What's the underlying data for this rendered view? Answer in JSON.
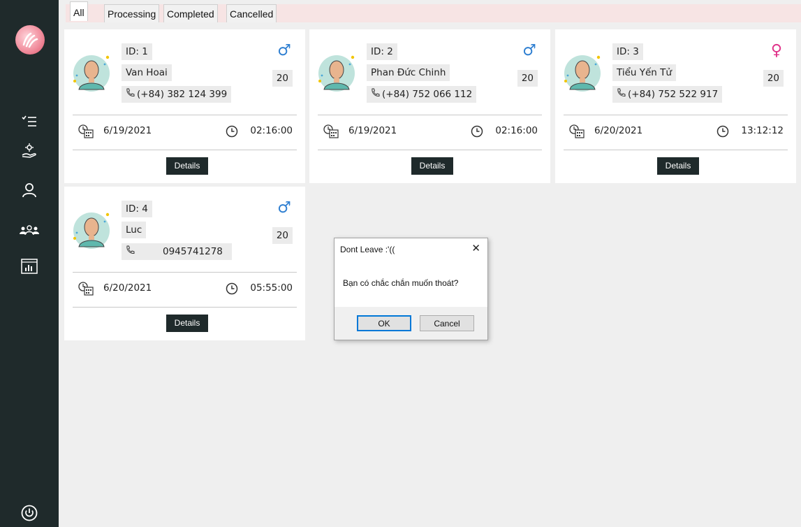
{
  "tabs": [
    {
      "label": "All",
      "active": true
    },
    {
      "label": "Processing",
      "active": false
    },
    {
      "label": "Completed",
      "active": false
    },
    {
      "label": "Cancelled",
      "active": false
    }
  ],
  "sidebar": {
    "items": [
      {
        "icon": "checklist-icon"
      },
      {
        "icon": "hand-gear-icon"
      },
      {
        "icon": "user-icon"
      },
      {
        "icon": "users-group-icon"
      },
      {
        "icon": "report-chart-icon"
      }
    ],
    "power_icon": "power-icon"
  },
  "cards": [
    {
      "id": "ID: 1",
      "name": "Van Hoai",
      "phone": "(+84) 382 124 399",
      "gender": "male",
      "age": "20",
      "date": "6/19/2021",
      "time": "02:16:00",
      "details_label": "Details"
    },
    {
      "id": "ID: 2",
      "name": "Phan Đức Chinh",
      "phone": "(+84) 752 066 112",
      "gender": "male",
      "age": "20",
      "date": "6/19/2021",
      "time": "02:16:00",
      "details_label": "Details"
    },
    {
      "id": "ID: 3",
      "name": "Tiểu Yến Tử",
      "phone": "(+84) 752 522 917",
      "gender": "female",
      "age": "20",
      "date": "6/20/2021",
      "time": "13:12:12",
      "details_label": "Details"
    },
    {
      "id": "ID: 4",
      "name": "Luc",
      "phone": "0945741278",
      "gender": "male",
      "age": "20",
      "date": "6/20/2021",
      "time": "05:55:00",
      "details_label": "Details"
    }
  ],
  "dialog": {
    "title": "Dont Leave :'((",
    "message": "Bạn có chắc chắn muốn thoát?",
    "ok_label": "OK",
    "cancel_label": "Cancel"
  },
  "colors": {
    "sidebar_bg": "#1f2a2b",
    "tabbar_bg": "#f7e4e4",
    "male": "#2f7fd1",
    "female": "#e0338a",
    "button_dark": "#1f2a2b",
    "dialog_ok_border": "#0078d7"
  }
}
